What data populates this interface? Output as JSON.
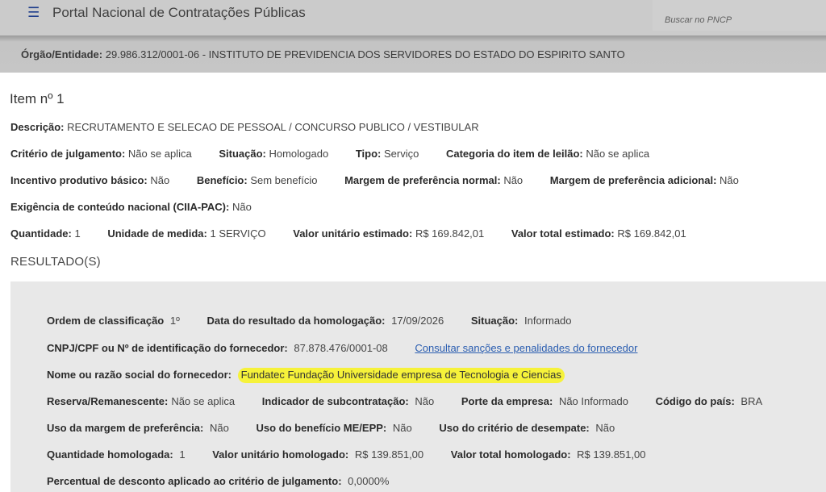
{
  "header": {
    "title": "Portal Nacional de Contratações Públicas",
    "search_placeholder": "Buscar no PNCP",
    "menu_icon": "hamburger-icon"
  },
  "orgao": {
    "label": "Órgão/Entidade:",
    "value": "29.986.312/0001-06 - INSTITUTO DE PREVIDENCIA DOS SERVIDORES DO ESTADO DO ESPIRITO SANTO"
  },
  "item": {
    "title": "Item nº 1",
    "descricao_label": "Descrição:",
    "descricao": "RECRUTAMENTO E SELECAO DE PESSOAL / CONCURSO PUBLICO / VESTIBULAR",
    "criterio_label": "Critério de julgamento:",
    "criterio": "Não se aplica",
    "situacao_label": "Situação:",
    "situacao": "Homologado",
    "tipo_label": "Tipo:",
    "tipo": "Serviço",
    "categoria_label": "Categoria do item de leilão:",
    "categoria": "Não se aplica",
    "incentivo_label": "Incentivo produtivo básico:",
    "incentivo": "Não",
    "beneficio_label": "Benefício:",
    "beneficio": "Sem benefício",
    "margem_normal_label": "Margem de preferência normal:",
    "margem_normal": "Não",
    "margem_adicional_label": "Margem de preferência adicional:",
    "margem_adicional": "Não",
    "exigencia_label": "Exigência de conteúdo nacional (CIIA-PAC):",
    "exigencia": "Não",
    "quantidade_label": "Quantidade:",
    "quantidade": "1",
    "unidade_label": "Unidade de medida:",
    "unidade": "1 SERVIÇO",
    "valor_unitario_label": "Valor unitário estimado:",
    "valor_unitario": "R$ 169.842,01",
    "valor_total_label": "Valor total estimado:",
    "valor_total": "R$ 169.842,01"
  },
  "resultado": {
    "section_title": "RESULTADO(S)",
    "ordem_label": "Ordem de classificação",
    "ordem": "1º",
    "data_label": "Data do resultado da homologação:",
    "data": "17/09/2026",
    "situacao_label": "Situação:",
    "situacao": "Informado",
    "cnpj_label": "CNPJ/CPF ou Nº de identificação do fornecedor:",
    "cnpj": "87.878.476/0001-08",
    "sancoes_link": "Consultar sanções e penalidades do fornecedor",
    "nome_label": "Nome ou razão social do fornecedor:",
    "nome": "Fundatec Fundação Universidade empresa de Tecnologia e Ciencias",
    "reserva_label": "Reserva/Remanescente:",
    "reserva": "Não se aplica",
    "subcontratacao_label": "Indicador de subcontratação:",
    "subcontratacao": "Não",
    "porte_label": "Porte da empresa:",
    "porte": "Não Informado",
    "pais_label": "Código do país:",
    "pais": "BRA",
    "uso_margem_label": "Uso da margem de preferência:",
    "uso_margem": "Não",
    "uso_beneficio_label": "Uso do benefício ME/EPP:",
    "uso_beneficio": "Não",
    "uso_desempate_label": "Uso do critério de desempate:",
    "uso_desempate": "Não",
    "qtd_homologada_label": "Quantidade homologada:",
    "qtd_homologada": "1",
    "valor_unit_homologado_label": "Valor unitário homologado:",
    "valor_unit_homologado": "R$ 139.851,00",
    "valor_total_homologado_label": "Valor total homologado:",
    "valor_total_homologado": "R$ 139.851,00",
    "percentual_label": "Percentual de desconto aplicado ao critério de julgamento:",
    "percentual": "0,0000%",
    "highlight_color": "#f6f23a"
  }
}
